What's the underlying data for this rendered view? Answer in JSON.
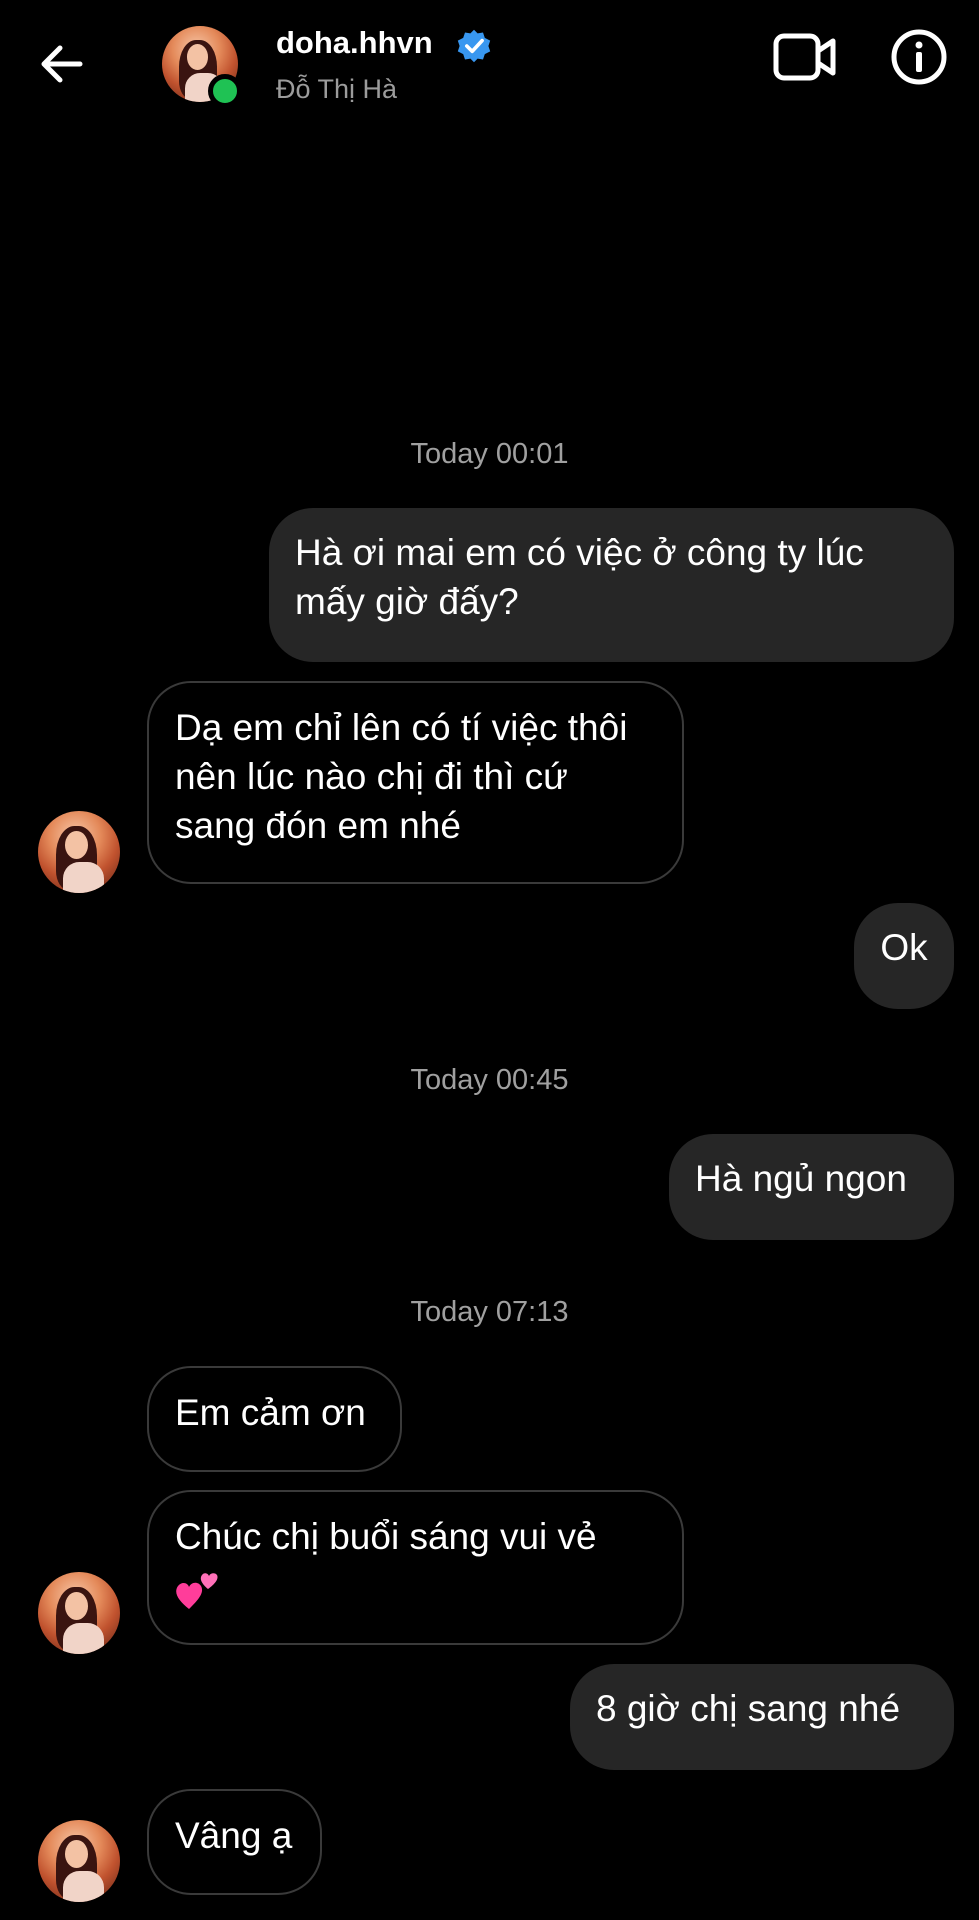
{
  "header": {
    "username": "doha.hhvn",
    "real_name": "Đỗ Thị Hà",
    "back_icon": "arrow-left-icon",
    "video_icon": "video-call-icon",
    "info_icon": "info-icon",
    "verified_icon": "verified-badge-icon",
    "online_color": "#1fc254",
    "verified_color": "#3897f0"
  },
  "timestamps": [
    "Today 00:01",
    "Today 00:45",
    "Today 07:13"
  ],
  "messages": [
    {
      "from": "me",
      "text": "Hà ơi mai em có việc ở công ty lúc mấy giờ đấy?"
    },
    {
      "from": "them",
      "text": "Dạ em chỉ lên có tí việc thôi nên lúc nào chị đi thì cứ sang đón em nhé"
    },
    {
      "from": "me",
      "text": "Ok"
    },
    {
      "from": "me",
      "text": "Hà ngủ ngon"
    },
    {
      "from": "them",
      "text": "Em cảm ơn"
    },
    {
      "from": "them",
      "text": "Chúc chị buổi sáng vui vẻ",
      "emoji_icon": "two-hearts-icon"
    },
    {
      "from": "me",
      "text": "8 giờ chị sang nhé"
    },
    {
      "from": "them",
      "text": "Vâng ạ"
    }
  ],
  "colors": {
    "background": "#000000",
    "outgoing_bubble": "#262626",
    "incoming_border": "#3a3a3a",
    "timestamp": "#a0a0a0"
  }
}
